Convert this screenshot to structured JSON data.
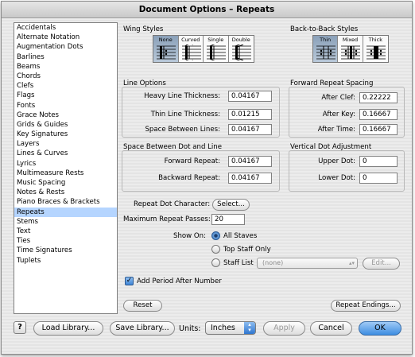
{
  "window": {
    "title": "Document Options – Repeats"
  },
  "sidebar": {
    "items": [
      {
        "label": "Accidentals"
      },
      {
        "label": "Alternate Notation"
      },
      {
        "label": "Augmentation Dots"
      },
      {
        "label": "Barlines"
      },
      {
        "label": "Beams"
      },
      {
        "label": "Chords"
      },
      {
        "label": "Clefs"
      },
      {
        "label": "Flags"
      },
      {
        "label": "Fonts"
      },
      {
        "label": "Grace Notes"
      },
      {
        "label": "Grids & Guides"
      },
      {
        "label": "Key Signatures"
      },
      {
        "label": "Layers"
      },
      {
        "label": "Lines & Curves"
      },
      {
        "label": "Lyrics"
      },
      {
        "label": "Multimeasure Rests"
      },
      {
        "label": "Music Spacing"
      },
      {
        "label": "Notes & Rests"
      },
      {
        "label": "Piano Braces & Brackets"
      },
      {
        "label": "Repeats",
        "selected": true
      },
      {
        "label": "Stems"
      },
      {
        "label": "Text"
      },
      {
        "label": "Ties"
      },
      {
        "label": "Time Signatures"
      },
      {
        "label": "Tuplets"
      }
    ]
  },
  "wing_styles": {
    "title": "Wing Styles",
    "options": [
      {
        "label": "None",
        "active": true,
        "icon": "wing-none-icon"
      },
      {
        "label": "Curved",
        "active": false,
        "icon": "wing-curved-icon"
      },
      {
        "label": "Single",
        "active": false,
        "icon": "wing-single-icon"
      },
      {
        "label": "Double",
        "active": false,
        "icon": "wing-double-icon"
      }
    ]
  },
  "b2b_styles": {
    "title": "Back-to-Back Styles",
    "options": [
      {
        "label": "Thin",
        "active": true,
        "icon": "b2b-thin-icon"
      },
      {
        "label": "Mixed",
        "active": false,
        "icon": "b2b-mixed-icon"
      },
      {
        "label": "Thick",
        "active": false,
        "icon": "b2b-thick-icon"
      }
    ]
  },
  "line_options": {
    "title": "Line Options",
    "heavy_label": "Heavy Line Thickness:",
    "heavy_value": "0.04167",
    "thin_label": "Thin Line Thickness:",
    "thin_value": "0.01215",
    "space_label": "Space Between Lines:",
    "space_value": "0.04167"
  },
  "dot_line": {
    "title": "Space Between Dot and Line",
    "forward_label": "Forward Repeat:",
    "forward_value": "0.04167",
    "backward_label": "Backward Repeat:",
    "backward_value": "0.04167"
  },
  "forward_spacing": {
    "title": "Forward Repeat Spacing",
    "clef_label": "After Clef:",
    "clef_value": "0.22222",
    "key_label": "After Key:",
    "key_value": "0.16667",
    "time_label": "After Time:",
    "time_value": "0.16667"
  },
  "vertical_dot": {
    "title": "Vertical Dot Adjustment",
    "upper_label": "Upper Dot:",
    "upper_value": "0",
    "lower_label": "Lower Dot:",
    "lower_value": "0"
  },
  "repeat_dot": {
    "label": "Repeat Dot Character:",
    "button": "Select..."
  },
  "max_passes": {
    "label": "Maximum Repeat Passes:",
    "value": "20"
  },
  "show_on": {
    "label": "Show On:",
    "options": [
      {
        "label": "All Staves",
        "checked": true
      },
      {
        "label": "Top Staff Only",
        "checked": false
      },
      {
        "label": "Staff List",
        "checked": false
      }
    ],
    "staff_list_value": "(none)",
    "edit_button": "Edit..."
  },
  "add_period": {
    "label": "Add Period After Number",
    "checked": true
  },
  "reset_button": "Reset",
  "repeat_endings_button": "Repeat Endings...",
  "footer": {
    "help": "?",
    "load_library": "Load Library...",
    "save_library": "Save Library...",
    "units_label": "Units:",
    "units_value": "Inches",
    "apply": "Apply",
    "cancel": "Cancel",
    "ok": "OK"
  }
}
